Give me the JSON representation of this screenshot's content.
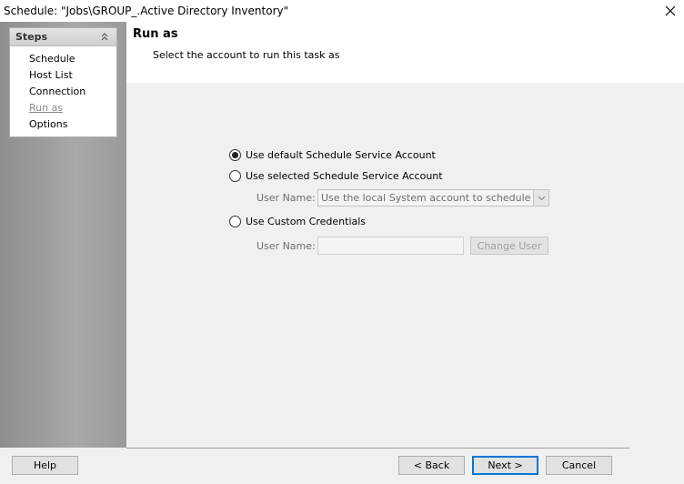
{
  "window": {
    "title": "Schedule: \"Jobs\\GROUP_.Active Directory Inventory\"",
    "close_icon": "close-icon"
  },
  "steps": {
    "title": "Steps",
    "items": [
      {
        "label": "Schedule"
      },
      {
        "label": "Host List"
      },
      {
        "label": "Connection"
      },
      {
        "label": "Run as",
        "current": true
      },
      {
        "label": "Options"
      }
    ]
  },
  "header": {
    "title": "Run as",
    "subtitle": "Select the account to run this task as"
  },
  "options": {
    "default_account": {
      "label": "Use default Schedule Service Account",
      "selected": true
    },
    "selected_account": {
      "label": "Use selected Schedule Service Account",
      "selected": false,
      "user_name_label": "User Name:",
      "user_name_value": "Use the local System account to schedule task"
    },
    "custom_credentials": {
      "label": "Use Custom Credentials",
      "selected": false,
      "user_name_label": "User Name:",
      "user_name_value": "",
      "change_user_label": "Change User"
    }
  },
  "footer": {
    "help_label": "Help",
    "back_label": "< Back",
    "next_label": "Next >",
    "cancel_label": "Cancel"
  }
}
